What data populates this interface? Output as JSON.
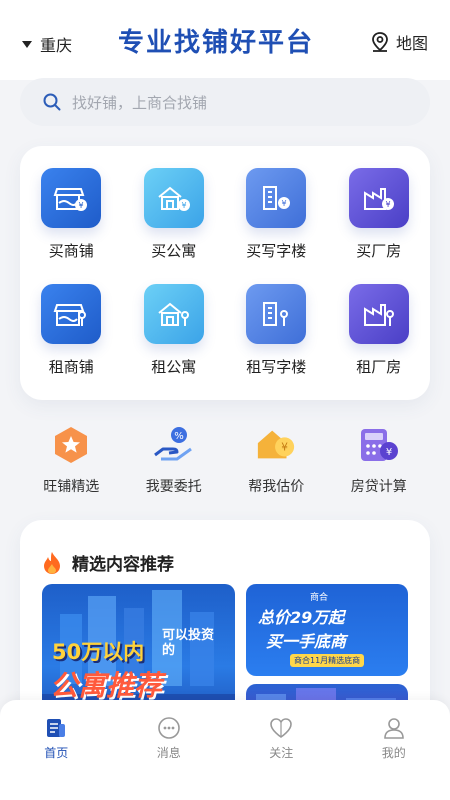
{
  "header": {
    "city": "重庆",
    "brand": "专业找铺好平台",
    "map_label": "地图"
  },
  "search": {
    "placeholder": "找好铺，上商合找铺"
  },
  "categories": [
    {
      "label": "买商铺",
      "icon": "shop-coin-icon",
      "color": "#2a6fe0"
    },
    {
      "label": "买公寓",
      "icon": "apartment-coin-icon",
      "color": "#48b2ee"
    },
    {
      "label": "买写字楼",
      "icon": "office-coin-icon",
      "color": "#4d7de0"
    },
    {
      "label": "买厂房",
      "icon": "factory-coin-icon",
      "color": "#5a4ed6"
    },
    {
      "label": "租商铺",
      "icon": "shop-key-icon",
      "color": "#2a6fe0"
    },
    {
      "label": "租公寓",
      "icon": "apartment-key-icon",
      "color": "#48b2ee"
    },
    {
      "label": "租写字楼",
      "icon": "office-key-icon",
      "color": "#4d7de0"
    },
    {
      "label": "租厂房",
      "icon": "factory-key-icon",
      "color": "#5a4ed6"
    }
  ],
  "tools": [
    {
      "label": "旺铺精选",
      "icon": "star-badge-icon"
    },
    {
      "label": "我要委托",
      "icon": "hand-percent-icon"
    },
    {
      "label": "帮我估价",
      "icon": "house-yuan-icon"
    },
    {
      "label": "房贷计算",
      "icon": "calculator-icon"
    }
  ],
  "recommend": {
    "title": "精选内容推荐",
    "banner_left": {
      "line1": "50万以内",
      "line2": "可以投资的",
      "line3": "公寓推荐"
    },
    "banner_right_top": {
      "logo": "商合",
      "line1": "总价29万起",
      "line2": "买一手底商",
      "sub": "商合11月精选底商"
    }
  },
  "tabbar": [
    {
      "label": "首页",
      "icon": "home-doc-icon",
      "active": true
    },
    {
      "label": "消息",
      "icon": "message-icon",
      "active": false
    },
    {
      "label": "关注",
      "icon": "heart-icon",
      "active": false
    },
    {
      "label": "我的",
      "icon": "user-icon",
      "active": false
    }
  ]
}
